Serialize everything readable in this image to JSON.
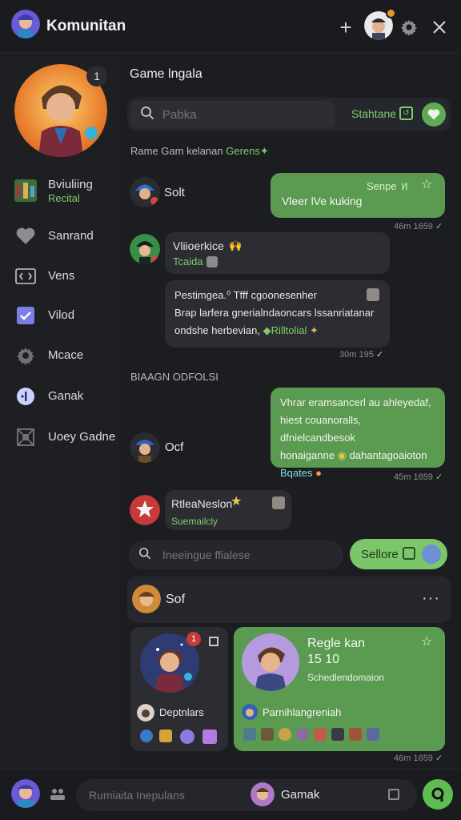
{
  "colors": {
    "accent": "#5faa54",
    "accent_text": "#7ccd6d",
    "outgoing_bubble": "#5b9a51",
    "incoming_bubble": "#2c2d32",
    "background": "#1c1d21"
  },
  "app": {
    "title": "Komunitan"
  },
  "top": {
    "plus_icon": "plus-icon",
    "gear_icon": "gear-icon",
    "close_icon": "close-icon"
  },
  "sidebar": {
    "profile_badge": "1",
    "items": [
      {
        "label": "Bviuliing",
        "sublabel": "Recital",
        "icon": "game-thumbnail-icon"
      },
      {
        "label": "Sanrand",
        "icon": "heart-icon"
      },
      {
        "label": "Vens",
        "icon": "code-icon"
      },
      {
        "label": "Vilod",
        "icon": "checkbox-icon"
      },
      {
        "label": "Mcace",
        "icon": "gear-icon"
      },
      {
        "label": "Ganak",
        "icon": "info-icon"
      },
      {
        "label": "Uoey Gadne",
        "icon": "frame-icon"
      }
    ]
  },
  "main": {
    "title": "Game lngala",
    "search": {
      "placeholder": "Pabka",
      "status": "Stahtane"
    },
    "section1": {
      "text": "Rame Gam kelanan ",
      "accent": "Gerens"
    },
    "section2": "BIAAGN ODFOLSI",
    "messages": {
      "m1": {
        "sender": "Solt",
        "bubble_title": "Senpe",
        "bubble_badge": "l⁄l",
        "bubble_text": "Vleer lVe kuking",
        "time": "46m 1659"
      },
      "m2": {
        "sender": "Vliioerkice",
        "emoji1": "🙌",
        "sub": "Tcaida"
      },
      "m3": {
        "line1": "Pestimgea.⁰ Tfff cgoonesenher",
        "line2": "Brap larfera gnerialndaoncars lssanriatanar",
        "line3a": "ondshe herbevian,",
        "line3b": "Rilltolial",
        "time": "30m 195"
      },
      "m4": {
        "line1": "Vhrar eramsancerl au ahleyedaf,",
        "line2": "hiest couanoralls, dfnielcandbesok",
        "line3": "honaiganne",
        "line3b": "dahantagoaioton",
        "line4": "Bqates",
        "time": "45m 1659",
        "sender": "Ocf"
      },
      "m5": {
        "sender": "RtleaNeslon",
        "sub": "Suemailcly"
      }
    },
    "search2": {
      "placeholder": "Ineeingue ffialese"
    },
    "action_pill": {
      "label": "Sellore"
    },
    "card": {
      "sender": "Sof",
      "more": "···"
    },
    "tile_left": {
      "badge": "1",
      "name": "Deptnlars"
    },
    "tile_right": {
      "title": "Regle kan",
      "count": "15 10",
      "sub": "Schedlendomaion",
      "user": "Parnihlangreniah",
      "time": "46m 1659"
    }
  },
  "bottom": {
    "composer_placeholder": "Rumiaita Inepulans",
    "user_name": "Gamak"
  }
}
